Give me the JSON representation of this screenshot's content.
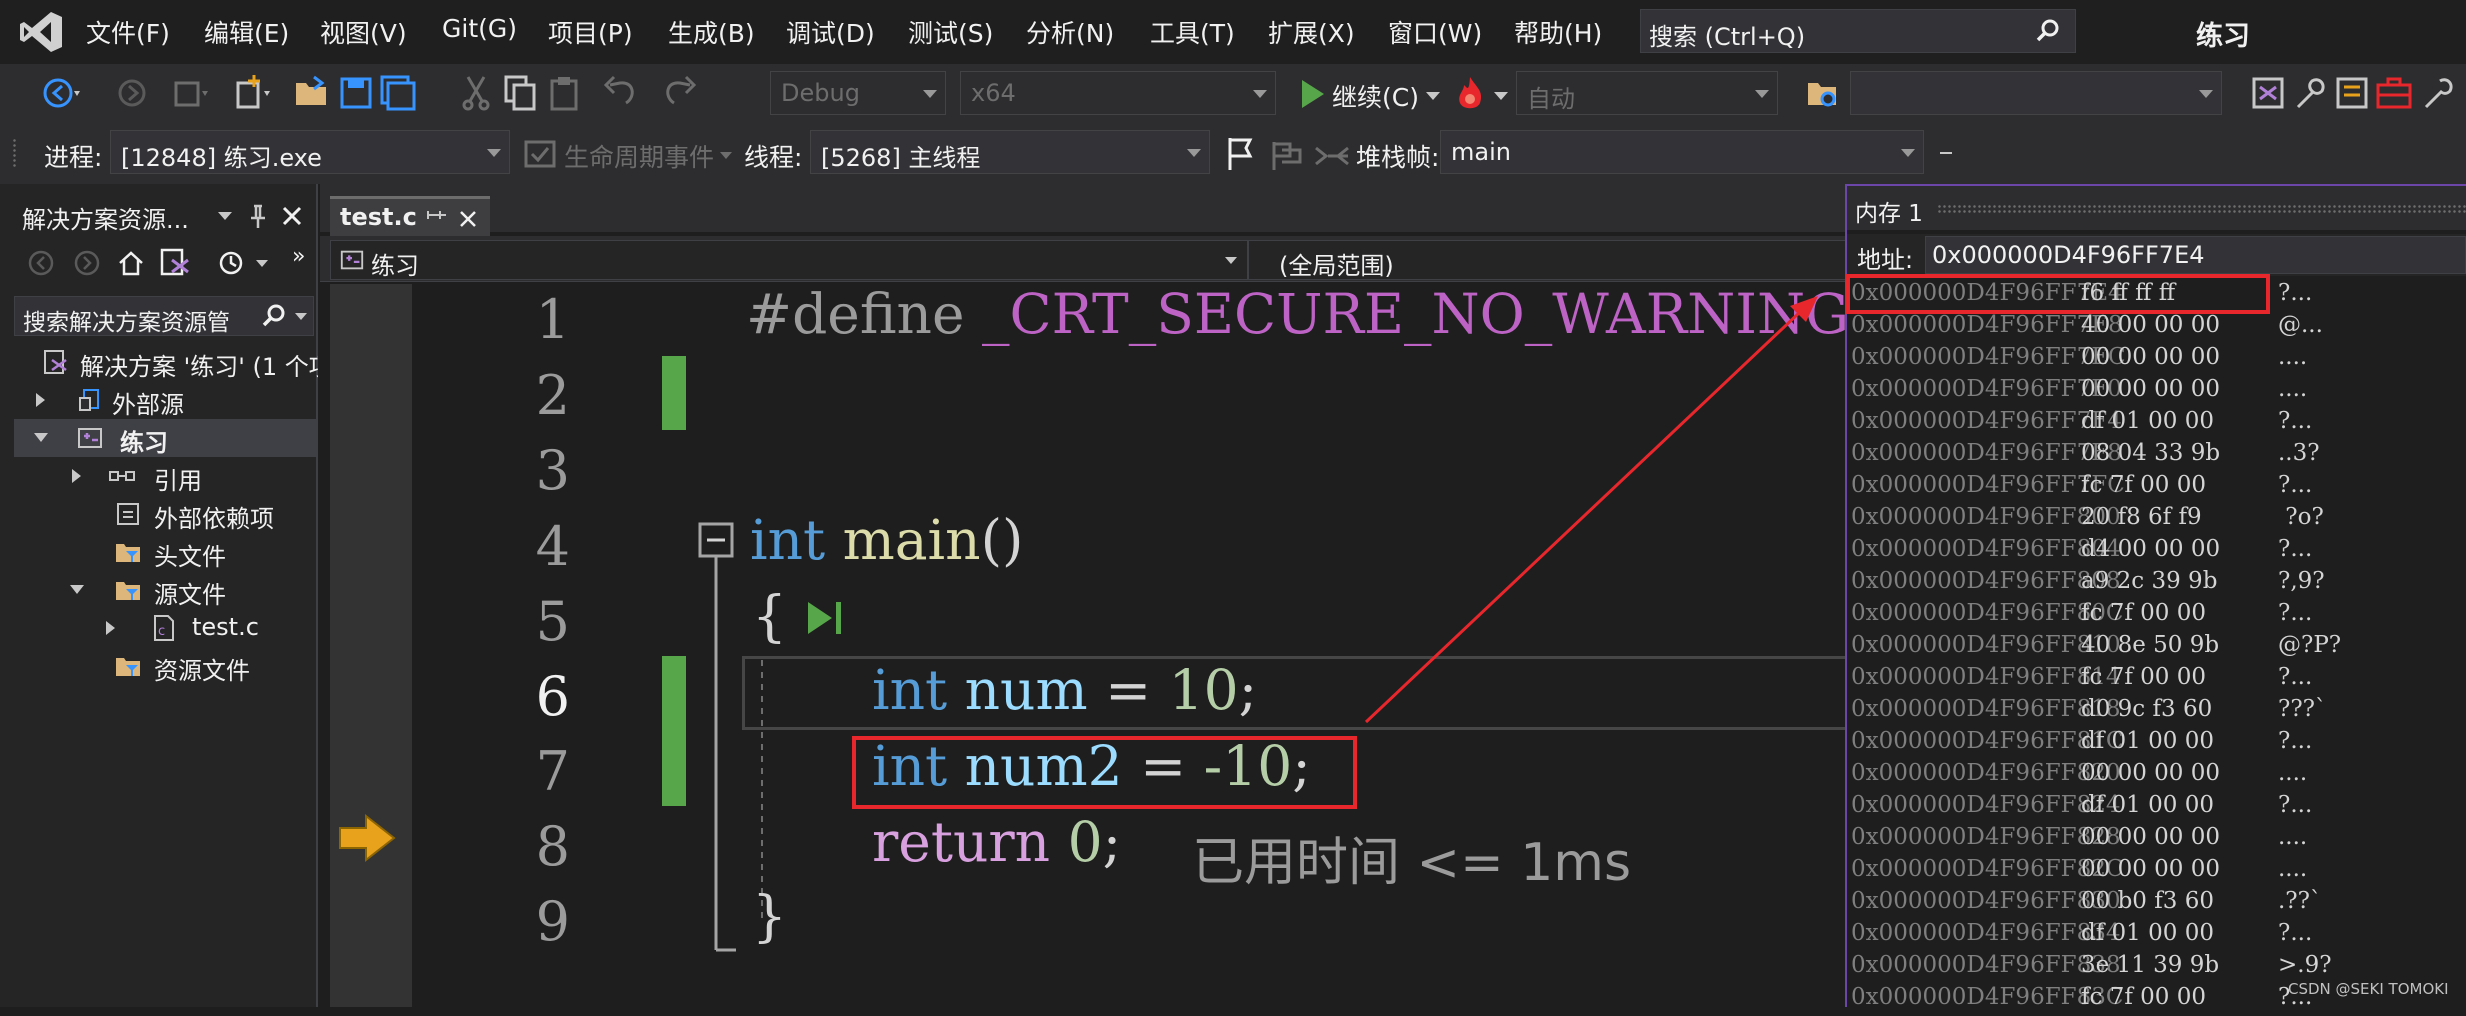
{
  "menu": {
    "items": [
      "文件(F)",
      "编辑(E)",
      "视图(V)",
      "Git(G)",
      "项目(P)",
      "生成(B)",
      "调试(D)",
      "测试(S)",
      "分析(N)",
      "工具(T)",
      "扩展(X)",
      "窗口(W)",
      "帮助(H)"
    ],
    "search_text": "搜索 (Ctrl+Q)",
    "window_title": "练习"
  },
  "toolbar1": {
    "config": "Debug",
    "platform": "x64",
    "continue_label": "继续(C)",
    "auto": "自动"
  },
  "toolbar2": {
    "process_label": "进程:",
    "process_value": "[12848] 练习.exe",
    "lifecycle_label": "生命周期事件",
    "thread_label": "线程:",
    "thread_value": "[5268] 主线程",
    "stackframe_label": "堆栈帧:",
    "stackframe_value": "main"
  },
  "solution_explorer": {
    "title": "解决方案资源...",
    "search_placeholder": "搜索解决方案资源管",
    "tree": [
      {
        "label": "解决方案 '练习' (1 个项",
        "level": 0,
        "expander": "none",
        "icon": "solution-icon"
      },
      {
        "label": "外部源",
        "level": 0,
        "expander": "closed",
        "icon": "external-source-icon"
      },
      {
        "label": "练习",
        "level": 0,
        "expander": "open",
        "icon": "project-icon",
        "selected": true
      },
      {
        "label": "引用",
        "level": 1,
        "expander": "closed",
        "icon": "references-icon"
      },
      {
        "label": "外部依赖项",
        "level": 1,
        "expander": "none",
        "icon": "folder-icon"
      },
      {
        "label": "头文件",
        "level": 1,
        "expander": "none",
        "icon": "folder-icon"
      },
      {
        "label": "源文件",
        "level": 1,
        "expander": "open",
        "icon": "folder-icon"
      },
      {
        "label": "test.c",
        "level": 2,
        "expander": "closed",
        "icon": "c-file-icon"
      },
      {
        "label": "资源文件",
        "level": 1,
        "expander": "none",
        "icon": "folder-icon"
      }
    ]
  },
  "editor": {
    "tab_name": "test.c",
    "nav_project": "练习",
    "nav_scope": "(全局范围)",
    "line_numbers": [
      "1",
      "2",
      "3",
      "4",
      "5",
      "6",
      "7",
      "8",
      "9"
    ],
    "code": {
      "l1_define": "#define",
      "l1_macro": "_CRT_SECURE_NO_WARNINGS",
      "l4_int": "int",
      "l4_main": "main",
      "l4_paren": "()",
      "l5_brace": "{",
      "l6_int": "int",
      "l6_var": "num",
      "l6_eq": " = ",
      "l6_num": "10",
      "l6_semi": ";",
      "l7_int": "int",
      "l7_var": "num2",
      "l7_eq": " = ",
      "l7_num": "-10",
      "l7_semi": ";",
      "l8_return": "return",
      "l8_num": "0",
      "l8_semi": ";",
      "l9_brace": "}"
    },
    "perf_tip": "已用时间 <= 1ms"
  },
  "memory": {
    "title": "内存 1",
    "address_label": "地址:",
    "address_value": "0x000000D4F96FF7E4",
    "rows": [
      {
        "addr": "0x000000D4F96FF7E4",
        "bytes": "f6 ff ff ff",
        "chars": "?..."
      },
      {
        "addr": "0x000000D4F96FF7E8",
        "bytes": "40 00 00 00",
        "chars": "@..."
      },
      {
        "addr": "0x000000D4F96FF7EC",
        "bytes": "00 00 00 00",
        "chars": "...."
      },
      {
        "addr": "0x000000D4F96FF7F0",
        "bytes": "00 00 00 00",
        "chars": "...."
      },
      {
        "addr": "0x000000D4F96FF7F4",
        "bytes": "df 01 00 00",
        "chars": "?..."
      },
      {
        "addr": "0x000000D4F96FF7F8",
        "bytes": "08 04 33 9b",
        "chars": "..3?"
      },
      {
        "addr": "0x000000D4F96FF7FC",
        "bytes": "fc 7f 00 00",
        "chars": "?..."
      },
      {
        "addr": "0x000000D4F96FF800",
        "bytes": "20 f8 6f f9",
        "chars": " ?o?"
      },
      {
        "addr": "0x000000D4F96FF804",
        "bytes": "d4 00 00 00",
        "chars": "?..."
      },
      {
        "addr": "0x000000D4F96FF808",
        "bytes": "a9 2c 39 9b",
        "chars": "?,9?"
      },
      {
        "addr": "0x000000D4F96FF80C",
        "bytes": "fc 7f 00 00",
        "chars": "?..."
      },
      {
        "addr": "0x000000D4F96FF810",
        "bytes": "40 8e 50 9b",
        "chars": "@?P?"
      },
      {
        "addr": "0x000000D4F96FF814",
        "bytes": "fc 7f 00 00",
        "chars": "?..."
      },
      {
        "addr": "0x000000D4F96FF818",
        "bytes": "d0 9c f3 60",
        "chars": "???`"
      },
      {
        "addr": "0x000000D4F96FF81C",
        "bytes": "df 01 00 00",
        "chars": "?..."
      },
      {
        "addr": "0x000000D4F96FF820",
        "bytes": "00 00 00 00",
        "chars": "...."
      },
      {
        "addr": "0x000000D4F96FF824",
        "bytes": "df 01 00 00",
        "chars": "?..."
      },
      {
        "addr": "0x000000D4F96FF828",
        "bytes": "00 00 00 00",
        "chars": "...."
      },
      {
        "addr": "0x000000D4F96FF82C",
        "bytes": "00 00 00 00",
        "chars": "...."
      },
      {
        "addr": "0x000000D4F96FF830",
        "bytes": "00 b0 f3 60",
        "chars": ".??`"
      },
      {
        "addr": "0x000000D4F96FF834",
        "bytes": "df 01 00 00",
        "chars": "?..."
      },
      {
        "addr": "0x000000D4F96FF838",
        "bytes": "3e 11 39 9b",
        "chars": ">.9?"
      },
      {
        "addr": "0x000000D4F96FF83C",
        "bytes": "fc 7f 00 00",
        "chars": "?..."
      }
    ]
  },
  "watermark": "CSDN @SEKI TOMOKI",
  "colors": {
    "annotation": "#e8272d",
    "keyword": "#569cd6",
    "function": "#dcdcaa",
    "variable": "#9cdcfe",
    "number": "#b5cea8",
    "macro": "#bd63c5",
    "change_bar": "#57a64a",
    "breakpoint_arrow": "#e9a21b"
  }
}
